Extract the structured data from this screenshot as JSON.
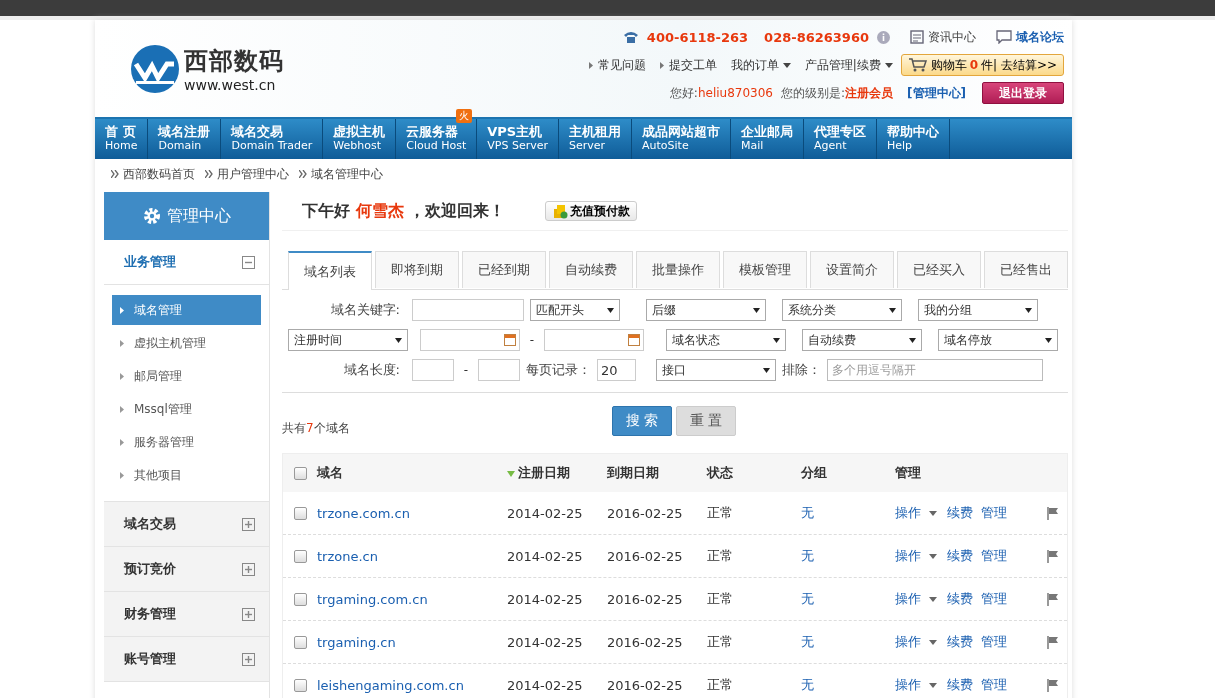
{
  "header": {
    "logo": {
      "name": "西部数码",
      "url": "www.west.cn"
    },
    "phones": [
      "400-6118-263",
      "028-86263960"
    ],
    "top_links": [
      {
        "label": "资讯中心",
        "kind": "plain"
      },
      {
        "label": "域名论坛",
        "kind": "bold"
      }
    ],
    "menu": [
      {
        "label": "常见问题",
        "kind": "link"
      },
      {
        "label": "提交工单",
        "kind": "link"
      },
      {
        "label": "我的订单",
        "kind": "dropdown"
      },
      {
        "label": "产品管理|续费",
        "kind": "dropdown"
      }
    ],
    "cart": {
      "label": "购物车",
      "count": "0",
      "unit": "件|",
      "checkout": "去结算>>"
    },
    "user": {
      "greeting": "您好:",
      "name": "heliu870306",
      "level_label": "您的级别是:",
      "level": "注册会员",
      "admin": "[管理中心]",
      "logout": "退出登录"
    }
  },
  "nav": [
    {
      "title": "首 页",
      "sub": "Home"
    },
    {
      "title": "域名注册",
      "sub": "Domain"
    },
    {
      "title": "域名交易",
      "sub": "Domain Trader"
    },
    {
      "title": "虚拟主机",
      "sub": "Webhost"
    },
    {
      "title": "云服务器",
      "sub": "Cloud Host",
      "badge": "火"
    },
    {
      "title": "VPS主机",
      "sub": "VPS Server"
    },
    {
      "title": "主机租用",
      "sub": "Server"
    },
    {
      "title": "成品网站超市",
      "sub": "AutoSite"
    },
    {
      "title": "企业邮局",
      "sub": "Mail"
    },
    {
      "title": "代理专区",
      "sub": "Agent"
    },
    {
      "title": "帮助中心",
      "sub": "Help"
    }
  ],
  "breadcrumb": [
    "西部数码首页",
    "用户管理中心",
    "域名管理中心"
  ],
  "sidebar": {
    "title": "管理中心",
    "groups": [
      {
        "label": "业务管理",
        "expanded": true,
        "items": [
          {
            "label": "域名管理",
            "selected": true
          },
          {
            "label": "虚拟主机管理",
            "selected": false
          },
          {
            "label": "邮局管理",
            "selected": false
          },
          {
            "label": "Mssql管理",
            "selected": false
          },
          {
            "label": "服务器管理",
            "selected": false
          },
          {
            "label": "其他项目",
            "selected": false
          }
        ]
      },
      {
        "label": "域名交易",
        "expanded": false
      },
      {
        "label": "预订竞价",
        "expanded": false
      },
      {
        "label": "财务管理",
        "expanded": false
      },
      {
        "label": "账号管理",
        "expanded": false
      }
    ]
  },
  "welcome": {
    "greeting": "下午好",
    "name": "何雪杰",
    "suffix": "，欢迎回来！",
    "recharge": "充值预付款"
  },
  "tabs": [
    {
      "label": "域名列表",
      "selected": true
    },
    {
      "label": "即将到期",
      "selected": false
    },
    {
      "label": "已经到期",
      "selected": false
    },
    {
      "label": "自动续费",
      "selected": false
    },
    {
      "label": "批量操作",
      "selected": false
    },
    {
      "label": "模板管理",
      "selected": false
    },
    {
      "label": "设置简介",
      "selected": false
    },
    {
      "label": "已经买入",
      "selected": false
    },
    {
      "label": "已经售出",
      "selected": false
    }
  ],
  "filters": [
    [
      {
        "kind": "label",
        "text": "域名关键字:"
      },
      {
        "kind": "input"
      },
      {
        "kind": "select",
        "value": "匹配开头"
      },
      {
        "kind": "select",
        "value": "后缀"
      },
      {
        "kind": "select",
        "value": "系统分类"
      },
      {
        "kind": "select",
        "value": "我的分组"
      }
    ],
    [
      {
        "kind": "select",
        "value": "注册时间"
      },
      {
        "kind": "date"
      },
      {
        "kind": "dash",
        "text": "-"
      },
      {
        "kind": "date"
      },
      {
        "kind": "select",
        "value": "域名状态"
      },
      {
        "kind": "select",
        "value": "自动续费"
      },
      {
        "kind": "select",
        "value": "域名停放"
      }
    ],
    [
      {
        "kind": "label",
        "text": "域名长度:"
      },
      {
        "kind": "short"
      },
      {
        "kind": "dash",
        "text": "-"
      },
      {
        "kind": "short"
      },
      {
        "kind": "label",
        "text": "每页记录："
      },
      {
        "kind": "number",
        "value": "20"
      },
      {
        "kind": "select",
        "value": "接口"
      },
      {
        "kind": "label",
        "text": "排除："
      },
      {
        "kind": "wide",
        "placeholder": "多个用逗号隔开"
      }
    ]
  ],
  "count": {
    "prefix": "共有",
    "count": "7",
    "suffix": "个域名"
  },
  "buttons": {
    "search": "搜 索",
    "reset": "重 置"
  },
  "table": {
    "all_checked": false,
    "columns": [
      {
        "label": "域名",
        "sorted": false
      },
      {
        "label": "注册日期",
        "sorted": true
      },
      {
        "label": "到期日期",
        "sorted": false
      },
      {
        "label": "状态",
        "sorted": false
      },
      {
        "label": "分组",
        "sorted": false
      },
      {
        "label": "管理",
        "sorted": false
      }
    ],
    "rows": [
      {
        "checked": false,
        "domain": "trzone.com.cn",
        "registered": "2014-02-25",
        "expires": "2016-02-25",
        "status": "正常",
        "group": "无",
        "actions": [
          "操作",
          "续费",
          "管理"
        ]
      },
      {
        "checked": false,
        "domain": "trzone.cn",
        "registered": "2014-02-25",
        "expires": "2016-02-25",
        "status": "正常",
        "group": "无",
        "actions": [
          "操作",
          "续费",
          "管理"
        ]
      },
      {
        "checked": false,
        "domain": "trgaming.com.cn",
        "registered": "2014-02-25",
        "expires": "2016-02-25",
        "status": "正常",
        "group": "无",
        "actions": [
          "操作",
          "续费",
          "管理"
        ]
      },
      {
        "checked": false,
        "domain": "trgaming.cn",
        "registered": "2014-02-25",
        "expires": "2016-02-25",
        "status": "正常",
        "group": "无",
        "actions": [
          "操作",
          "续费",
          "管理"
        ]
      },
      {
        "checked": false,
        "domain": "leishengaming.com.cn",
        "registered": "2014-02-25",
        "expires": "2016-02-25",
        "status": "正常",
        "group": "无",
        "actions": [
          "操作",
          "续费",
          "管理"
        ]
      }
    ]
  }
}
